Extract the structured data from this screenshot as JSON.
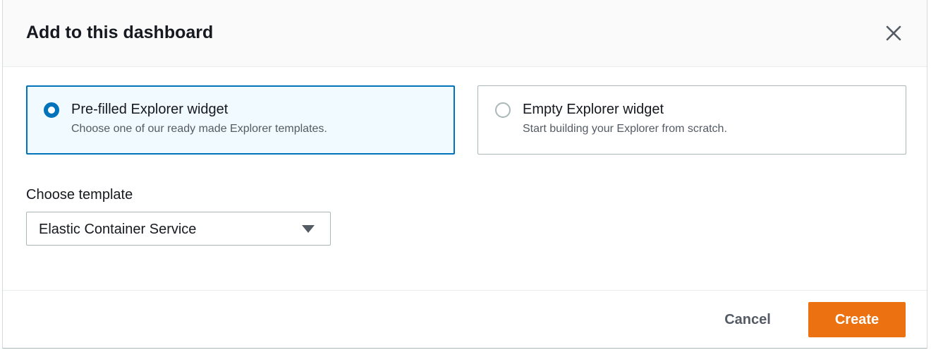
{
  "dialog": {
    "title": "Add to this dashboard",
    "close_icon": "close-icon"
  },
  "widget_options": [
    {
      "title": "Pre-filled Explorer widget",
      "description": "Choose one of our ready made Explorer templates.",
      "selected": true
    },
    {
      "title": "Empty Explorer widget",
      "description": "Start building your Explorer from scratch.",
      "selected": false
    }
  ],
  "template": {
    "label": "Choose template",
    "selected_value": "Elastic Container Service",
    "caret_icon": "caret-down-icon"
  },
  "footer": {
    "cancel_label": "Cancel",
    "create_label": "Create"
  },
  "colors": {
    "accent": "#0073bb",
    "selected_background": "#f1faff",
    "primary_button": "#ec7211",
    "text": "#16191f",
    "secondary_text": "#545b64"
  }
}
